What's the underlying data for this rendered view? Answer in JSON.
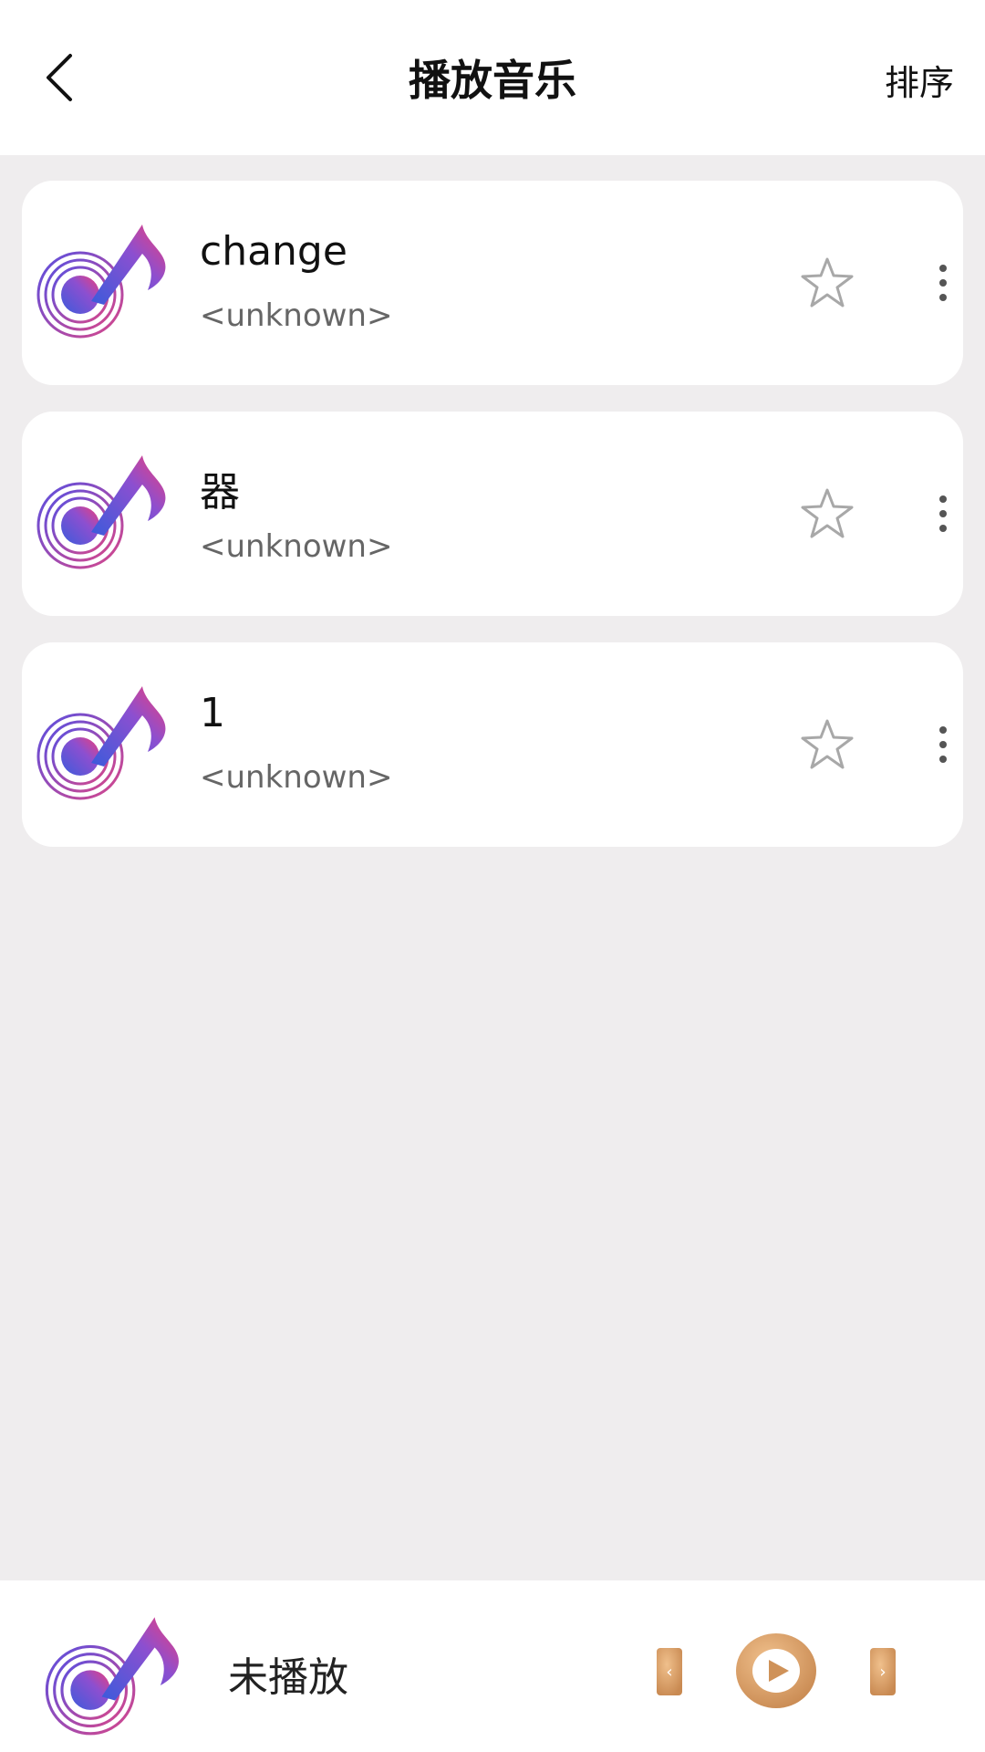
{
  "header": {
    "title": "播放音乐",
    "sort_label": "排序",
    "back_icon": "chevron-left-icon"
  },
  "tracks": [
    {
      "title": "change",
      "artist": "<unknown>"
    },
    {
      "title": "器",
      "artist": "<unknown>"
    },
    {
      "title": "1",
      "artist": "<unknown>"
    }
  ],
  "player": {
    "status": "未播放",
    "prev_label": "‹",
    "next_label": "›"
  },
  "colors": {
    "background": "#efedee",
    "card": "#ffffff",
    "accent_blue": "#3b5bdb",
    "accent_pink": "#e0457b",
    "player_button": "#d49a63"
  }
}
